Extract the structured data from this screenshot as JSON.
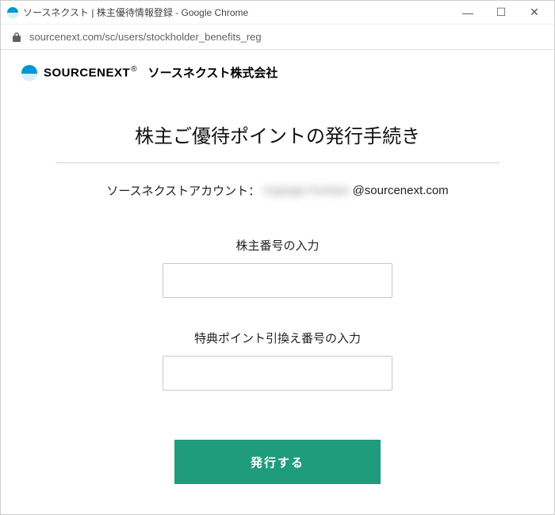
{
  "window": {
    "title": "ソースネクスト | 株主優待情報登録 - Google Chrome",
    "minimize": "—",
    "maximize": "☐",
    "close": "✕"
  },
  "addressbar": {
    "url": "sourcenext.com/sc/users/stockholder_benefits_reg"
  },
  "brand": {
    "wordmark": "SOURCENEXT",
    "reg": "®",
    "jp": "ソースネクスト株式会社"
  },
  "page": {
    "heading": "株主ご優待ポイントの発行手続き",
    "account_label": "ソースネクストアカウント：",
    "account_masked": "mypage-honban",
    "account_domain": "@sourcenext.com",
    "field1_label": "株主番号の入力",
    "field2_label": "特典ポイント引換え番号の入力",
    "submit_label": "発行する"
  }
}
